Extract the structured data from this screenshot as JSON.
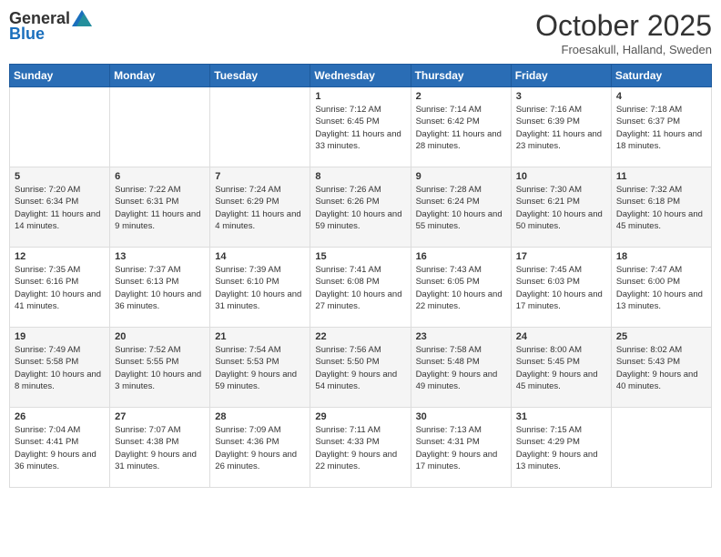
{
  "logo": {
    "general": "General",
    "blue": "Blue"
  },
  "header": {
    "month": "October 2025",
    "location": "Froesakull, Halland, Sweden"
  },
  "weekdays": [
    "Sunday",
    "Monday",
    "Tuesday",
    "Wednesday",
    "Thursday",
    "Friday",
    "Saturday"
  ],
  "weeks": [
    [
      {
        "day": "",
        "info": ""
      },
      {
        "day": "",
        "info": ""
      },
      {
        "day": "",
        "info": ""
      },
      {
        "day": "1",
        "info": "Sunrise: 7:12 AM\nSunset: 6:45 PM\nDaylight: 11 hours\nand 33 minutes."
      },
      {
        "day": "2",
        "info": "Sunrise: 7:14 AM\nSunset: 6:42 PM\nDaylight: 11 hours\nand 28 minutes."
      },
      {
        "day": "3",
        "info": "Sunrise: 7:16 AM\nSunset: 6:39 PM\nDaylight: 11 hours\nand 23 minutes."
      },
      {
        "day": "4",
        "info": "Sunrise: 7:18 AM\nSunset: 6:37 PM\nDaylight: 11 hours\nand 18 minutes."
      }
    ],
    [
      {
        "day": "5",
        "info": "Sunrise: 7:20 AM\nSunset: 6:34 PM\nDaylight: 11 hours\nand 14 minutes."
      },
      {
        "day": "6",
        "info": "Sunrise: 7:22 AM\nSunset: 6:31 PM\nDaylight: 11 hours\nand 9 minutes."
      },
      {
        "day": "7",
        "info": "Sunrise: 7:24 AM\nSunset: 6:29 PM\nDaylight: 11 hours\nand 4 minutes."
      },
      {
        "day": "8",
        "info": "Sunrise: 7:26 AM\nSunset: 6:26 PM\nDaylight: 10 hours\nand 59 minutes."
      },
      {
        "day": "9",
        "info": "Sunrise: 7:28 AM\nSunset: 6:24 PM\nDaylight: 10 hours\nand 55 minutes."
      },
      {
        "day": "10",
        "info": "Sunrise: 7:30 AM\nSunset: 6:21 PM\nDaylight: 10 hours\nand 50 minutes."
      },
      {
        "day": "11",
        "info": "Sunrise: 7:32 AM\nSunset: 6:18 PM\nDaylight: 10 hours\nand 45 minutes."
      }
    ],
    [
      {
        "day": "12",
        "info": "Sunrise: 7:35 AM\nSunset: 6:16 PM\nDaylight: 10 hours\nand 41 minutes."
      },
      {
        "day": "13",
        "info": "Sunrise: 7:37 AM\nSunset: 6:13 PM\nDaylight: 10 hours\nand 36 minutes."
      },
      {
        "day": "14",
        "info": "Sunrise: 7:39 AM\nSunset: 6:10 PM\nDaylight: 10 hours\nand 31 minutes."
      },
      {
        "day": "15",
        "info": "Sunrise: 7:41 AM\nSunset: 6:08 PM\nDaylight: 10 hours\nand 27 minutes."
      },
      {
        "day": "16",
        "info": "Sunrise: 7:43 AM\nSunset: 6:05 PM\nDaylight: 10 hours\nand 22 minutes."
      },
      {
        "day": "17",
        "info": "Sunrise: 7:45 AM\nSunset: 6:03 PM\nDaylight: 10 hours\nand 17 minutes."
      },
      {
        "day": "18",
        "info": "Sunrise: 7:47 AM\nSunset: 6:00 PM\nDaylight: 10 hours\nand 13 minutes."
      }
    ],
    [
      {
        "day": "19",
        "info": "Sunrise: 7:49 AM\nSunset: 5:58 PM\nDaylight: 10 hours\nand 8 minutes."
      },
      {
        "day": "20",
        "info": "Sunrise: 7:52 AM\nSunset: 5:55 PM\nDaylight: 10 hours\nand 3 minutes."
      },
      {
        "day": "21",
        "info": "Sunrise: 7:54 AM\nSunset: 5:53 PM\nDaylight: 9 hours\nand 59 minutes."
      },
      {
        "day": "22",
        "info": "Sunrise: 7:56 AM\nSunset: 5:50 PM\nDaylight: 9 hours\nand 54 minutes."
      },
      {
        "day": "23",
        "info": "Sunrise: 7:58 AM\nSunset: 5:48 PM\nDaylight: 9 hours\nand 49 minutes."
      },
      {
        "day": "24",
        "info": "Sunrise: 8:00 AM\nSunset: 5:45 PM\nDaylight: 9 hours\nand 45 minutes."
      },
      {
        "day": "25",
        "info": "Sunrise: 8:02 AM\nSunset: 5:43 PM\nDaylight: 9 hours\nand 40 minutes."
      }
    ],
    [
      {
        "day": "26",
        "info": "Sunrise: 7:04 AM\nSunset: 4:41 PM\nDaylight: 9 hours\nand 36 minutes."
      },
      {
        "day": "27",
        "info": "Sunrise: 7:07 AM\nSunset: 4:38 PM\nDaylight: 9 hours\nand 31 minutes."
      },
      {
        "day": "28",
        "info": "Sunrise: 7:09 AM\nSunset: 4:36 PM\nDaylight: 9 hours\nand 26 minutes."
      },
      {
        "day": "29",
        "info": "Sunrise: 7:11 AM\nSunset: 4:33 PM\nDaylight: 9 hours\nand 22 minutes."
      },
      {
        "day": "30",
        "info": "Sunrise: 7:13 AM\nSunset: 4:31 PM\nDaylight: 9 hours\nand 17 minutes."
      },
      {
        "day": "31",
        "info": "Sunrise: 7:15 AM\nSunset: 4:29 PM\nDaylight: 9 hours\nand 13 minutes."
      },
      {
        "day": "",
        "info": ""
      }
    ]
  ]
}
